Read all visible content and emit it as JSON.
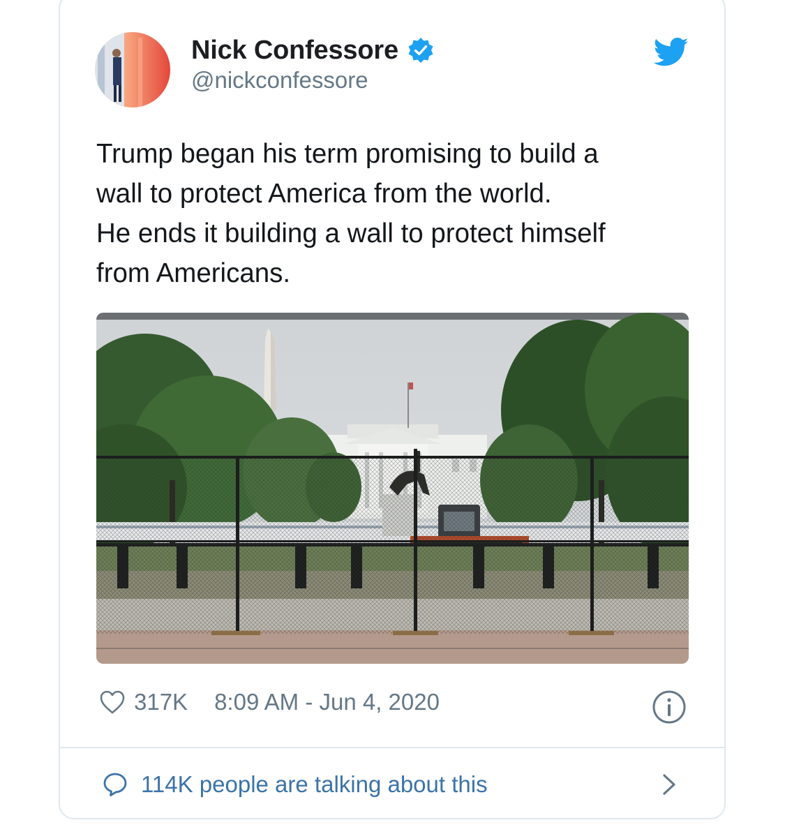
{
  "tweet": {
    "display_name": "Nick Confessore",
    "handle": "@nickconfessore",
    "verified": true,
    "text_lines": [
      "Trump began his term promising to build a",
      "wall to protect America from the world.",
      "He ends it building a wall to protect himself",
      "from Americans."
    ],
    "likes": "317K",
    "timestamp": "8:09 AM - Jun 4, 2020",
    "conversation": "114K people are talking about this"
  },
  "icons": {
    "verified": "verified-badge-icon",
    "bird": "twitter-bird-icon",
    "like": "heart-outline-icon",
    "info": "info-circle-icon",
    "reply": "speech-bubble-icon",
    "chevron": "chevron-right-icon"
  },
  "colors": {
    "twitter_blue": "#1da1f2",
    "link_blue": "#3b73a8",
    "secondary_text": "#657786",
    "border": "#e1e8ed"
  }
}
